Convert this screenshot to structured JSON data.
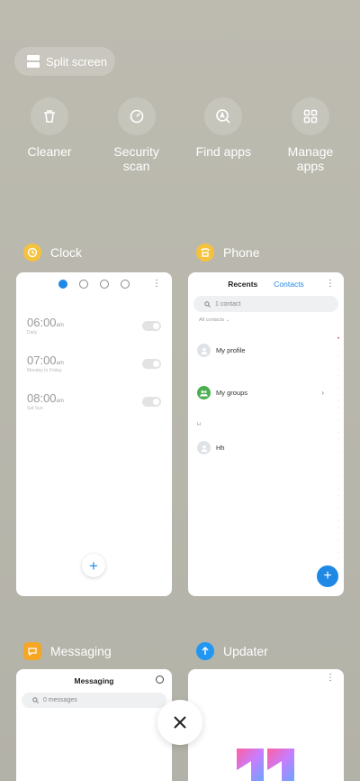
{
  "split_screen": {
    "label": "Split screen"
  },
  "tools": [
    {
      "label": "Cleaner",
      "icon": "trash-icon"
    },
    {
      "label": "Security scan",
      "icon": "security-icon"
    },
    {
      "label": "Find apps",
      "icon": "find-apps-icon"
    },
    {
      "label": "Manage apps",
      "icon": "grid-icon"
    }
  ],
  "apps": {
    "clock": {
      "name": "Clock",
      "alarms": [
        {
          "time": "06:00",
          "ampm": "am",
          "desc": "Daily"
        },
        {
          "time": "07:00",
          "ampm": "am",
          "desc": "Monday to Friday"
        },
        {
          "time": "08:00",
          "ampm": "am",
          "desc": "Sat Sun"
        }
      ]
    },
    "phone": {
      "name": "Phone",
      "tab_recents": "Recents",
      "tab_contacts": "Contacts",
      "search_placeholder": "1 contact",
      "filter_label": "All contacts",
      "rows": [
        {
          "label": "My profile"
        },
        {
          "label": "My groups"
        },
        {
          "label": "Hh"
        }
      ],
      "section_letter": "H"
    },
    "messaging": {
      "name": "Messaging",
      "title": "Messaging",
      "search_placeholder": "0 messages"
    },
    "updater": {
      "name": "Updater"
    }
  },
  "colors": {
    "accent": "#1e88e5",
    "clock_icon": "#f5c23e",
    "phone_icon": "#f5c23e",
    "messaging_icon": "#f5a623",
    "updater_icon": "#2196f3"
  }
}
